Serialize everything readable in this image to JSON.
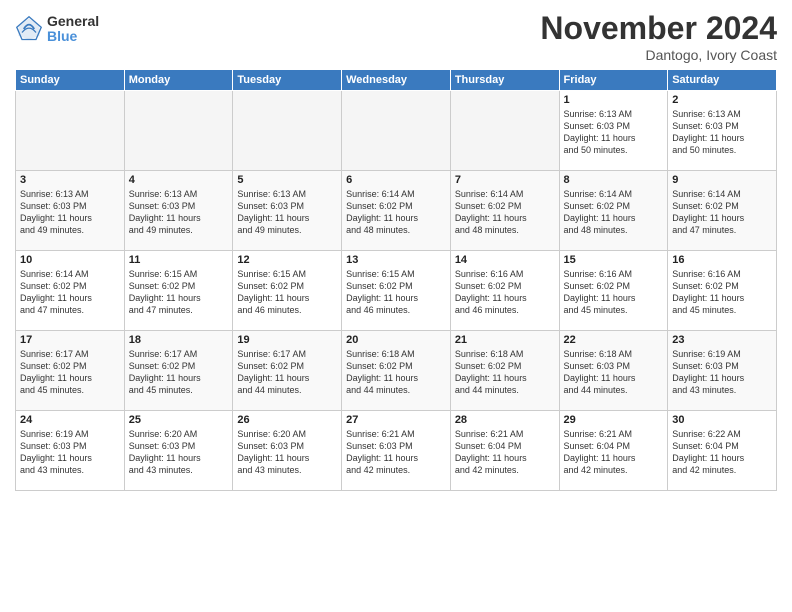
{
  "logo": {
    "general": "General",
    "blue": "Blue"
  },
  "header": {
    "month": "November 2024",
    "location": "Dantogo, Ivory Coast"
  },
  "weekdays": [
    "Sunday",
    "Monday",
    "Tuesday",
    "Wednesday",
    "Thursday",
    "Friday",
    "Saturday"
  ],
  "weeks": [
    [
      {
        "day": "",
        "info": ""
      },
      {
        "day": "",
        "info": ""
      },
      {
        "day": "",
        "info": ""
      },
      {
        "day": "",
        "info": ""
      },
      {
        "day": "",
        "info": ""
      },
      {
        "day": "1",
        "info": "Sunrise: 6:13 AM\nSunset: 6:03 PM\nDaylight: 11 hours\nand 50 minutes."
      },
      {
        "day": "2",
        "info": "Sunrise: 6:13 AM\nSunset: 6:03 PM\nDaylight: 11 hours\nand 50 minutes."
      }
    ],
    [
      {
        "day": "3",
        "info": "Sunrise: 6:13 AM\nSunset: 6:03 PM\nDaylight: 11 hours\nand 49 minutes."
      },
      {
        "day": "4",
        "info": "Sunrise: 6:13 AM\nSunset: 6:03 PM\nDaylight: 11 hours\nand 49 minutes."
      },
      {
        "day": "5",
        "info": "Sunrise: 6:13 AM\nSunset: 6:03 PM\nDaylight: 11 hours\nand 49 minutes."
      },
      {
        "day": "6",
        "info": "Sunrise: 6:14 AM\nSunset: 6:02 PM\nDaylight: 11 hours\nand 48 minutes."
      },
      {
        "day": "7",
        "info": "Sunrise: 6:14 AM\nSunset: 6:02 PM\nDaylight: 11 hours\nand 48 minutes."
      },
      {
        "day": "8",
        "info": "Sunrise: 6:14 AM\nSunset: 6:02 PM\nDaylight: 11 hours\nand 48 minutes."
      },
      {
        "day": "9",
        "info": "Sunrise: 6:14 AM\nSunset: 6:02 PM\nDaylight: 11 hours\nand 47 minutes."
      }
    ],
    [
      {
        "day": "10",
        "info": "Sunrise: 6:14 AM\nSunset: 6:02 PM\nDaylight: 11 hours\nand 47 minutes."
      },
      {
        "day": "11",
        "info": "Sunrise: 6:15 AM\nSunset: 6:02 PM\nDaylight: 11 hours\nand 47 minutes."
      },
      {
        "day": "12",
        "info": "Sunrise: 6:15 AM\nSunset: 6:02 PM\nDaylight: 11 hours\nand 46 minutes."
      },
      {
        "day": "13",
        "info": "Sunrise: 6:15 AM\nSunset: 6:02 PM\nDaylight: 11 hours\nand 46 minutes."
      },
      {
        "day": "14",
        "info": "Sunrise: 6:16 AM\nSunset: 6:02 PM\nDaylight: 11 hours\nand 46 minutes."
      },
      {
        "day": "15",
        "info": "Sunrise: 6:16 AM\nSunset: 6:02 PM\nDaylight: 11 hours\nand 45 minutes."
      },
      {
        "day": "16",
        "info": "Sunrise: 6:16 AM\nSunset: 6:02 PM\nDaylight: 11 hours\nand 45 minutes."
      }
    ],
    [
      {
        "day": "17",
        "info": "Sunrise: 6:17 AM\nSunset: 6:02 PM\nDaylight: 11 hours\nand 45 minutes."
      },
      {
        "day": "18",
        "info": "Sunrise: 6:17 AM\nSunset: 6:02 PM\nDaylight: 11 hours\nand 45 minutes."
      },
      {
        "day": "19",
        "info": "Sunrise: 6:17 AM\nSunset: 6:02 PM\nDaylight: 11 hours\nand 44 minutes."
      },
      {
        "day": "20",
        "info": "Sunrise: 6:18 AM\nSunset: 6:02 PM\nDaylight: 11 hours\nand 44 minutes."
      },
      {
        "day": "21",
        "info": "Sunrise: 6:18 AM\nSunset: 6:02 PM\nDaylight: 11 hours\nand 44 minutes."
      },
      {
        "day": "22",
        "info": "Sunrise: 6:18 AM\nSunset: 6:03 PM\nDaylight: 11 hours\nand 44 minutes."
      },
      {
        "day": "23",
        "info": "Sunrise: 6:19 AM\nSunset: 6:03 PM\nDaylight: 11 hours\nand 43 minutes."
      }
    ],
    [
      {
        "day": "24",
        "info": "Sunrise: 6:19 AM\nSunset: 6:03 PM\nDaylight: 11 hours\nand 43 minutes."
      },
      {
        "day": "25",
        "info": "Sunrise: 6:20 AM\nSunset: 6:03 PM\nDaylight: 11 hours\nand 43 minutes."
      },
      {
        "day": "26",
        "info": "Sunrise: 6:20 AM\nSunset: 6:03 PM\nDaylight: 11 hours\nand 43 minutes."
      },
      {
        "day": "27",
        "info": "Sunrise: 6:21 AM\nSunset: 6:03 PM\nDaylight: 11 hours\nand 42 minutes."
      },
      {
        "day": "28",
        "info": "Sunrise: 6:21 AM\nSunset: 6:04 PM\nDaylight: 11 hours\nand 42 minutes."
      },
      {
        "day": "29",
        "info": "Sunrise: 6:21 AM\nSunset: 6:04 PM\nDaylight: 11 hours\nand 42 minutes."
      },
      {
        "day": "30",
        "info": "Sunrise: 6:22 AM\nSunset: 6:04 PM\nDaylight: 11 hours\nand 42 minutes."
      }
    ]
  ]
}
